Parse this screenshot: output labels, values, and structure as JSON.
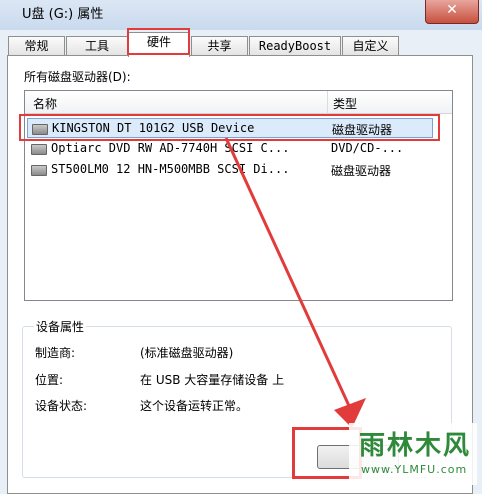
{
  "window": {
    "title": "U盘 (G:) 属性",
    "close_glyph": "✕"
  },
  "tabs": [
    {
      "label": "常规"
    },
    {
      "label": "工具"
    },
    {
      "label": "硬件",
      "active": true
    },
    {
      "label": "共享"
    },
    {
      "label": "ReadyBoost"
    },
    {
      "label": "自定义"
    }
  ],
  "drives_label": "所有磁盘驱动器(D):",
  "list": {
    "col_name": "名称",
    "col_type": "类型",
    "rows": [
      {
        "name": "KINGSTON DT 101G2 USB Device",
        "type": "磁盘驱动器",
        "selected": true
      },
      {
        "name": "Optiarc DVD RW AD-7740H SCSI C...",
        "type": "DVD/CD-..."
      },
      {
        "name": "ST500LM0 12 HN-M500MBB SCSI Di...",
        "type": "磁盘驱动器"
      }
    ]
  },
  "device_props": {
    "title": "设备属性",
    "manufacturer_label": "制造商:",
    "manufacturer_value": "(标准磁盘驱动器)",
    "location_label": "位置:",
    "location_value": "在 USB 大容量存储设备 上",
    "status_label": "设备状态:",
    "status_value": "这个设备运转正常。"
  },
  "watermark": {
    "main": "雨林木风",
    "url": "www.YLMFU.com"
  },
  "colors": {
    "highlight_red": "#e23b3b",
    "selection_blue": "#dcebfc"
  },
  "icons": {
    "close": "close-icon",
    "drive": "drive-icon"
  }
}
